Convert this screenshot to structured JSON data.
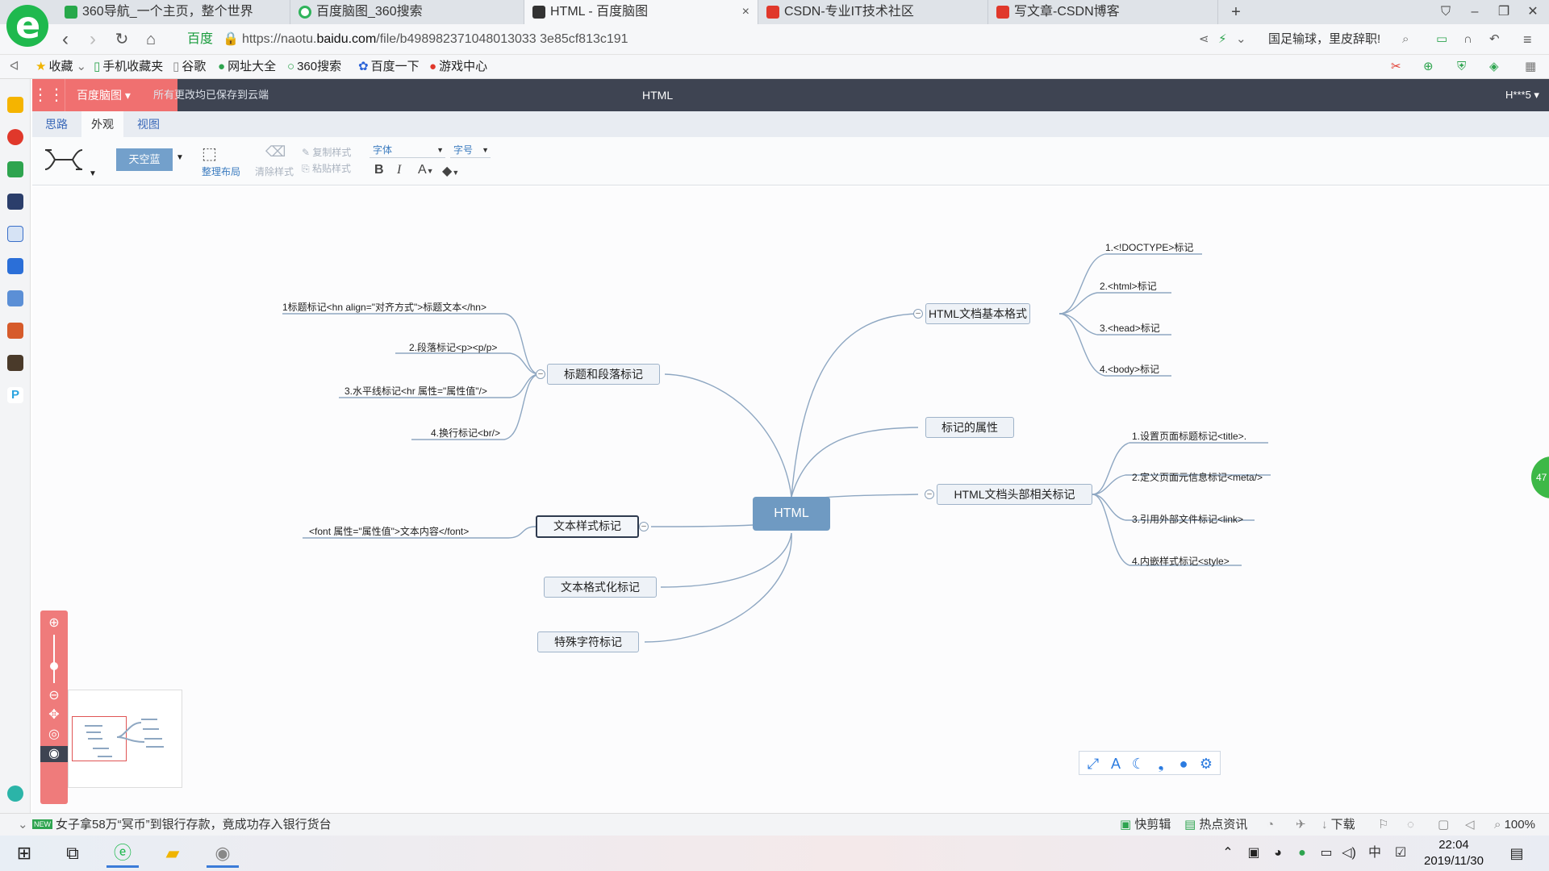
{
  "browser": {
    "tabs": [
      {
        "label": "360导航_一个主页，整个世界",
        "icon_color": "#27a84a"
      },
      {
        "label": "百度脑图_360搜索",
        "icon_color": "#2fb35a"
      },
      {
        "label": "HTML - 百度脑图",
        "icon_color": "#333333"
      },
      {
        "label": "CSDN-专业IT技术社区",
        "icon_color": "#e0382b"
      },
      {
        "label": "写文章-CSDN博客",
        "icon_color": "#e0382b"
      }
    ],
    "close_glyph": "×",
    "new_tab_glyph": "+",
    "site_label": "百度",
    "url_prefix": "https://naotu.",
    "url_domain": "baidu.com",
    "url_path": "/file/b498982371048013033 3e85cf813c191",
    "notice_text": "国足输球，里皮辞职!",
    "bookmarks": [
      "收藏",
      "手机收藏夹",
      "谷歌",
      "网址大全",
      "360搜索",
      "百度一下",
      "游戏中心"
    ]
  },
  "app": {
    "name": "百度脑图",
    "save_status": "所有更改均已保存到云端",
    "document_title": "HTML",
    "user": "H***5",
    "menu_tabs": [
      "思路",
      "外观",
      "视图"
    ],
    "active_menu_tab": "外观",
    "toolbar": {
      "theme_label": "天空蓝",
      "arrange_label": "整理布局",
      "clear_style_label": "清除样式",
      "copy_style_label": "复制样式",
      "paste_style_label": "粘贴样式",
      "font_placeholder": "字体",
      "font_size_placeholder": "字号",
      "bold": "B",
      "italic": "I",
      "font_color": "A"
    }
  },
  "mindmap": {
    "root": "HTML",
    "right_branches": [
      {
        "label": "HTML文档基本格式",
        "children": [
          "1.<!DOCTYPE>标记",
          "2.<html>标记",
          "3.<head>标记",
          "4.<body>标记"
        ]
      },
      {
        "label": "标记的属性",
        "children": []
      },
      {
        "label": "HTML文档头部相关标记",
        "children": [
          "1.设置页面标题标记<title>.",
          "2.定义页面元信息标记<meta/>",
          "3.引用外部文件标记<link>",
          "4.内嵌样式标记<style>"
        ]
      }
    ],
    "left_branches": [
      {
        "label": "标题和段落标记",
        "children": [
          "1标题标记<hn align=\"对齐方式\">标题文本</hn>",
          "2.段落标记<p><p/p>",
          "3.水平线标记<hr 属性=\"属性值\"/>",
          "4.换行标记<br/>"
        ]
      },
      {
        "label": "文本样式标记",
        "children": [
          "<font 属性=\"属性值\">文本内容</font>"
        ]
      },
      {
        "label": "文本格式化标记",
        "children": []
      },
      {
        "label": "特殊字符标记",
        "children": []
      }
    ]
  },
  "right_float_badge": "47",
  "statusbar": {
    "news_badge": "NEW",
    "news": "女子拿58万“冥币”到银行存款，竟成功存入银行货台",
    "items": [
      "快剪辑",
      "热点资讯",
      "下载"
    ],
    "zoom": "100%"
  },
  "taskbar": {
    "time": "22:04",
    "date": "2019/11/30",
    "ime": "中"
  }
}
